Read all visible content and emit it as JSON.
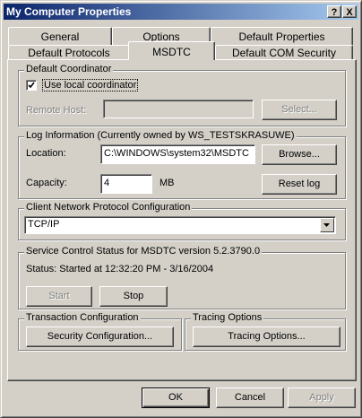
{
  "window": {
    "title": "My Computer Properties",
    "help_btn": "?",
    "close_btn": "X"
  },
  "tabs": {
    "row1": [
      "General",
      "Options",
      "Default Properties"
    ],
    "row2": [
      "Default Protocols",
      "MSDTC",
      "Default COM Security"
    ],
    "active": "MSDTC"
  },
  "default_coordinator": {
    "legend": "Default Coordinator",
    "checkbox_label": "Use local coordinator",
    "checked": true,
    "remote_host_label": "Remote Host:",
    "remote_host_value": "",
    "select_button": "Select..."
  },
  "log_info": {
    "legend": "Log Information (Currently owned by WS_TESTSKRASUWE)",
    "location_label": "Location:",
    "location_value": "C:\\WINDOWS\\system32\\MSDTC",
    "browse_button": "Browse...",
    "capacity_label": "Capacity:",
    "capacity_value": "4",
    "capacity_unit": "MB",
    "reset_button": "Reset log"
  },
  "client_network": {
    "legend": "Client Network Protocol Configuration",
    "selected": "TCP/IP"
  },
  "service_control": {
    "legend": "Service Control Status for MSDTC version 5.2.3790.0",
    "status": "Status: Started at 12:32:20 PM - 3/16/2004",
    "start_button": "Start",
    "stop_button": "Stop"
  },
  "transaction_config": {
    "legend": "Transaction Configuration",
    "button": "Security Configuration..."
  },
  "tracing_options": {
    "legend": "Tracing Options",
    "button": "Tracing Options..."
  },
  "footer": {
    "ok": "OK",
    "cancel": "Cancel",
    "apply": "Apply"
  }
}
